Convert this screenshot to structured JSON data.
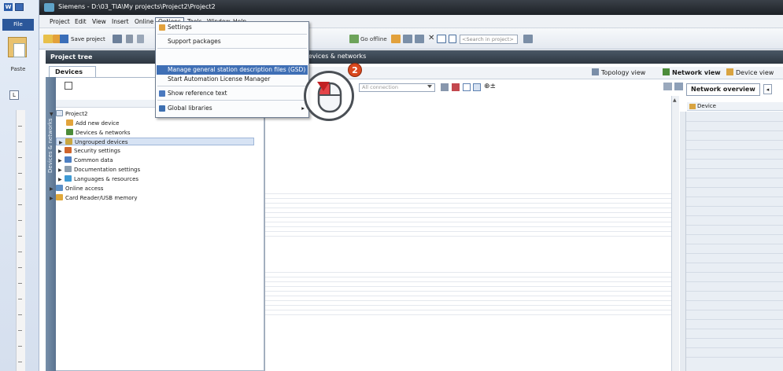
{
  "title_bar": {
    "title": "Siemens  -  D:\\03_TIA\\My projects\\Project2\\Project2"
  },
  "word": {
    "file_tab": "File",
    "paste_label": "Paste",
    "ruler_marker": "L"
  },
  "menu": {
    "items": [
      "Project",
      "Edit",
      "View",
      "Insert",
      "Online",
      "Options",
      "Tools",
      "Window",
      "Help"
    ],
    "active": "Options"
  },
  "toolbar": {
    "save_project": "Save project",
    "go_offline": "Go offline",
    "search_placeholder": "<Search in project>"
  },
  "options_menu": {
    "items": [
      {
        "label": "Settings",
        "icon": "settings-icon",
        "highlighted": false
      },
      {
        "label": "Support packages",
        "icon": "",
        "highlighted": false
      },
      {
        "label": "Manage general station description files (GSD)",
        "icon": "",
        "highlighted": true
      },
      {
        "label": "Start Automation License Manager",
        "icon": "",
        "highlighted": false
      },
      {
        "label": "Show reference text",
        "icon": "reference-text-icon",
        "highlighted": false
      },
      {
        "label": "Global libraries",
        "icon": "global-libraries-icon",
        "highlighted": false
      }
    ],
    "submenu_arrow": "▸"
  },
  "project_tree": {
    "header": "Project tree",
    "tab": "Devices",
    "side_label": "Devices & networks",
    "items": [
      {
        "label": "Project2",
        "arrow": "▼",
        "icon_color": "#dfe7f3"
      },
      {
        "label": "Add new device",
        "arrow": "",
        "icon_color": "#e2a43c"
      },
      {
        "label": "Devices & networks",
        "arrow": "",
        "icon_color": "#4c8c3a"
      },
      {
        "label": "Ungrouped devices",
        "arrow": "▶",
        "icon_color": "#c9a640",
        "selected": true
      },
      {
        "label": "Security settings",
        "arrow": "▶",
        "icon_color": "#d0652c"
      },
      {
        "label": "Common data",
        "arrow": "▶",
        "icon_color": "#4d7fc2"
      },
      {
        "label": "Documentation settings",
        "arrow": "▶",
        "icon_color": "#8b9dae"
      },
      {
        "label": "Languages & resources",
        "arrow": "▶",
        "icon_color": "#3e9ad4"
      },
      {
        "label": "Online access",
        "arrow": "▶",
        "icon_color": "#5c8fc6"
      },
      {
        "label": "Card Reader/USB memory",
        "arrow": "▶",
        "icon_color": "#e0a83a"
      }
    ]
  },
  "editor": {
    "header": "evices & networks",
    "topology_view": "Topology view",
    "network_view": "Network view",
    "device_view": "Device view",
    "connection_placeholder": "All connection"
  },
  "network_overview": {
    "tab": "Network overview",
    "tab_arrow": "◂",
    "column_device": "Device"
  },
  "callout": {
    "step": "2"
  },
  "colors": {
    "menu_highlight": "#3f6fb5",
    "panel_header": "#3a4652",
    "step_badge": "#d9481e"
  }
}
